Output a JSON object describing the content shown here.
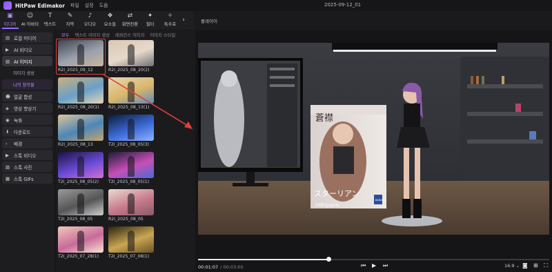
{
  "app": {
    "name": "HitPaw Edimakor",
    "menu": [
      "파일",
      "설정",
      "도움"
    ],
    "window_title": "2025-09-12_01"
  },
  "toolbar": {
    "tools": [
      {
        "label": "미디어",
        "icon": "folder-icon",
        "glyph": "▣",
        "active": true
      },
      {
        "label": "AI 아바타",
        "icon": "avatar-icon",
        "glyph": "☺",
        "active": false
      },
      {
        "label": "텍스트",
        "icon": "text-icon",
        "glyph": "T",
        "active": false
      },
      {
        "label": "자막",
        "icon": "subtitle-icon",
        "glyph": "✎",
        "active": false
      },
      {
        "label": "오디오",
        "icon": "audio-icon",
        "glyph": "♪",
        "active": false
      },
      {
        "label": "요소들",
        "icon": "elements-icon",
        "glyph": "❖",
        "active": false
      },
      {
        "label": "화면전환",
        "icon": "transition-icon",
        "glyph": "⇄",
        "active": false
      },
      {
        "label": "필터",
        "icon": "filter-icon",
        "glyph": "✦",
        "active": false
      },
      {
        "label": "특수효",
        "icon": "effects-icon",
        "glyph": "✧",
        "active": false
      }
    ],
    "scroll_glyph": "›"
  },
  "leftnav": {
    "items": [
      {
        "label": "로컬 미디어",
        "icon": "folder-icon",
        "glyph": "▤",
        "type": "item"
      },
      {
        "label": "AI 비디오",
        "icon": "ai-video-icon",
        "glyph": "▶",
        "type": "item"
      },
      {
        "label": "AI 이미지",
        "icon": "ai-image-icon",
        "glyph": "▧",
        "type": "item",
        "active": true
      },
      {
        "label": "이미지 생성",
        "type": "sub"
      },
      {
        "label": "나의 창작물",
        "type": "sub",
        "active": true
      },
      {
        "label": "얼굴 합성",
        "icon": "face-swap-icon",
        "glyph": "☻",
        "type": "item"
      },
      {
        "label": "영상 향상기",
        "icon": "enhance-icon",
        "glyph": "◈",
        "type": "item"
      },
      {
        "label": "녹화",
        "icon": "record-icon",
        "glyph": "◉",
        "type": "item"
      },
      {
        "label": "다운로드",
        "icon": "download-icon",
        "glyph": "⬇",
        "type": "item"
      },
      {
        "label": "배경",
        "icon": "chevron-right-icon",
        "glyph": "›",
        "type": "item"
      },
      {
        "label": "스톡 비디오",
        "icon": "stock-video-icon",
        "glyph": "▶",
        "type": "item"
      },
      {
        "label": "스톡 사진",
        "icon": "stock-photo-icon",
        "glyph": "▨",
        "type": "item"
      },
      {
        "label": "스톡 GIFs",
        "icon": "gif-icon",
        "glyph": "▦",
        "type": "item"
      }
    ]
  },
  "media": {
    "subtabs": [
      "모두",
      "텍스트 이미지 생성",
      "레퍼런스 이미지",
      "이미지 스타일"
    ],
    "items": [
      {
        "caption": "R2I_2025_09_12",
        "palette": [
          "#41464f",
          "#9aa1ad",
          "#c9b59b"
        ]
      },
      {
        "caption": "R2I_2025_08_20(2)",
        "palette": [
          "#d8c7b5",
          "#e7d9ca",
          "#6f6e75"
        ]
      },
      {
        "caption": "R2I_2025_08_20(1)",
        "palette": [
          "#c9b17e",
          "#6aa0c8",
          "#e4d6b6"
        ]
      },
      {
        "caption": "R2I_2025_08_13(1)",
        "palette": [
          "#e7d6b2",
          "#d9b66a",
          "#5b8bc1"
        ]
      },
      {
        "caption": "R2I_2025_08_13",
        "palette": [
          "#ddc59a",
          "#4d86b7",
          "#c8a46e"
        ]
      },
      {
        "caption": "T2I_2025_08_05(3)",
        "palette": [
          "#0d1a3a",
          "#3b6ad6",
          "#8fb1ff"
        ]
      },
      {
        "caption": "T2I_2025_08_05(2)",
        "palette": [
          "#1a1240",
          "#6a4bd6",
          "#d06fd6"
        ]
      },
      {
        "caption": "T2I_2025_08_05(1)",
        "palette": [
          "#1d1b3a",
          "#c64fb5",
          "#4b6ad6"
        ]
      },
      {
        "caption": "T2I_2025_08_05",
        "palette": [
          "#9a9a9a",
          "#555555",
          "#cfcfcf"
        ]
      },
      {
        "caption": "R2I_2025_08_05",
        "palette": [
          "#e9dccf",
          "#c77a8c",
          "#8a5a66"
        ]
      },
      {
        "caption": "T2I_2025_07_28(1)",
        "palette": [
          "#f0c8b8",
          "#c86b9a",
          "#f7e3d4"
        ]
      },
      {
        "caption": "T2I_2025_07_08(1)",
        "palette": [
          "#2b2410",
          "#caa653",
          "#6a5426"
        ]
      }
    ]
  },
  "player": {
    "header": "플레이어",
    "time_current": "00:01:07",
    "time_total": "/ 00:03:00",
    "progress": 0.372,
    "ratio_label": "16:9 ⌄",
    "controls": {
      "prev": "⏮",
      "play": "▶",
      "next": "⏭",
      "snapshot": "◙",
      "fit": "⊞",
      "fullscreen": "⛶"
    },
    "preview": {
      "box_title": "蒼襟",
      "box_text": "スターリアン",
      "box_subtitle": "SHFiguarts",
      "brand": "BANDAI"
    }
  }
}
